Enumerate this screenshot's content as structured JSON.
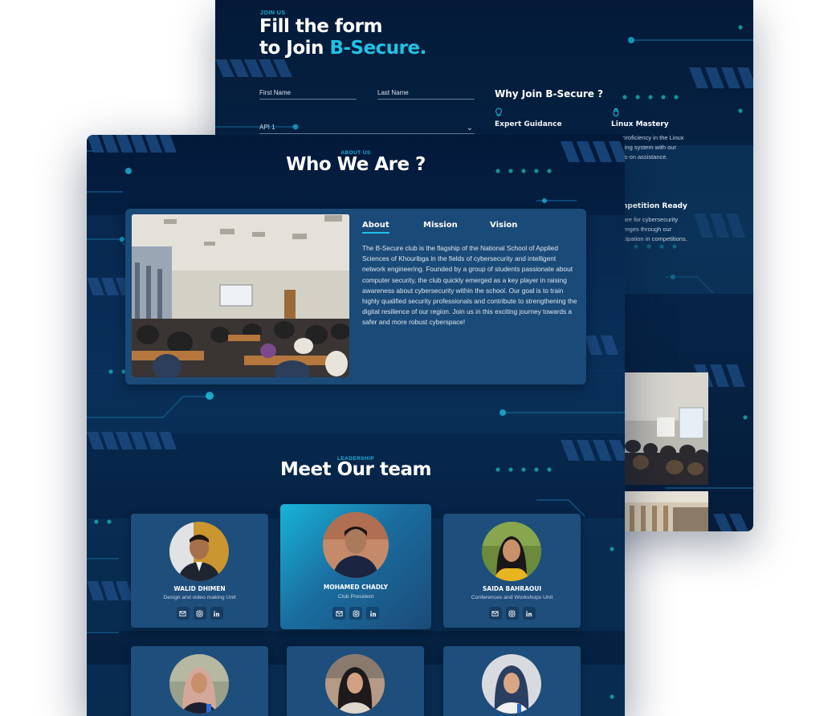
{
  "join": {
    "eyebrow": "JOIN US",
    "title_line1": "Fill the form",
    "title_line2_prefix": "to Join ",
    "title_line2_accent": "B-Secure.",
    "first_name_label": "First Name",
    "last_name_label": "Last Name",
    "select_value": "API 1"
  },
  "why": {
    "title": "Why Join B-Secure ?",
    "items": [
      {
        "icon": "lightbulb-icon",
        "title": "Expert Guidance",
        "text": ""
      },
      {
        "icon": "linux-icon",
        "title": "Linux Mastery",
        "text": "n proficiency in the Linux\nrating system with our\nnds-on assistance."
      },
      {
        "icon": "trophy-icon",
        "title": "mpetition Ready",
        "text": "pare for cybersecurity\nllenges through our\nticipation in competitions."
      }
    ]
  },
  "about": {
    "eyebrow": "ABOUT US",
    "title": "Who We Are ?",
    "tabs": [
      "About",
      "Mission",
      "Vision"
    ],
    "active_tab": 0,
    "text": "The B-Secure club is the flagship of the National School of Applied Sciences of Khouribga in the fields of cybersecurity and intelligent network engineering. Founded by a group of students passionate about computer security, the club quickly emerged as a key player in raising awareness about cybersecurity within the school. Our goal is to train highly qualified security professionals and contribute to strengthening the digital resilience of our region. Join us in this exciting journey towards a safer and more robust cyberspace!"
  },
  "team": {
    "eyebrow": "LEADERSHIP",
    "title": "Meet Our team",
    "members": [
      {
        "name": "WALID DHIMEN",
        "role": "Design and video making Unit"
      },
      {
        "name": "MOHAMED CHADLY",
        "role": "Club President"
      },
      {
        "name": "SAIDA BAHRAOUI",
        "role": "Conferences and Workshops Unit"
      }
    ],
    "social_icons": [
      "mail-icon",
      "instagram-icon",
      "linkedin-icon"
    ]
  },
  "colors": {
    "accent": "#1fc3e6",
    "background": "#06264a",
    "card": "#1d4e7c"
  }
}
